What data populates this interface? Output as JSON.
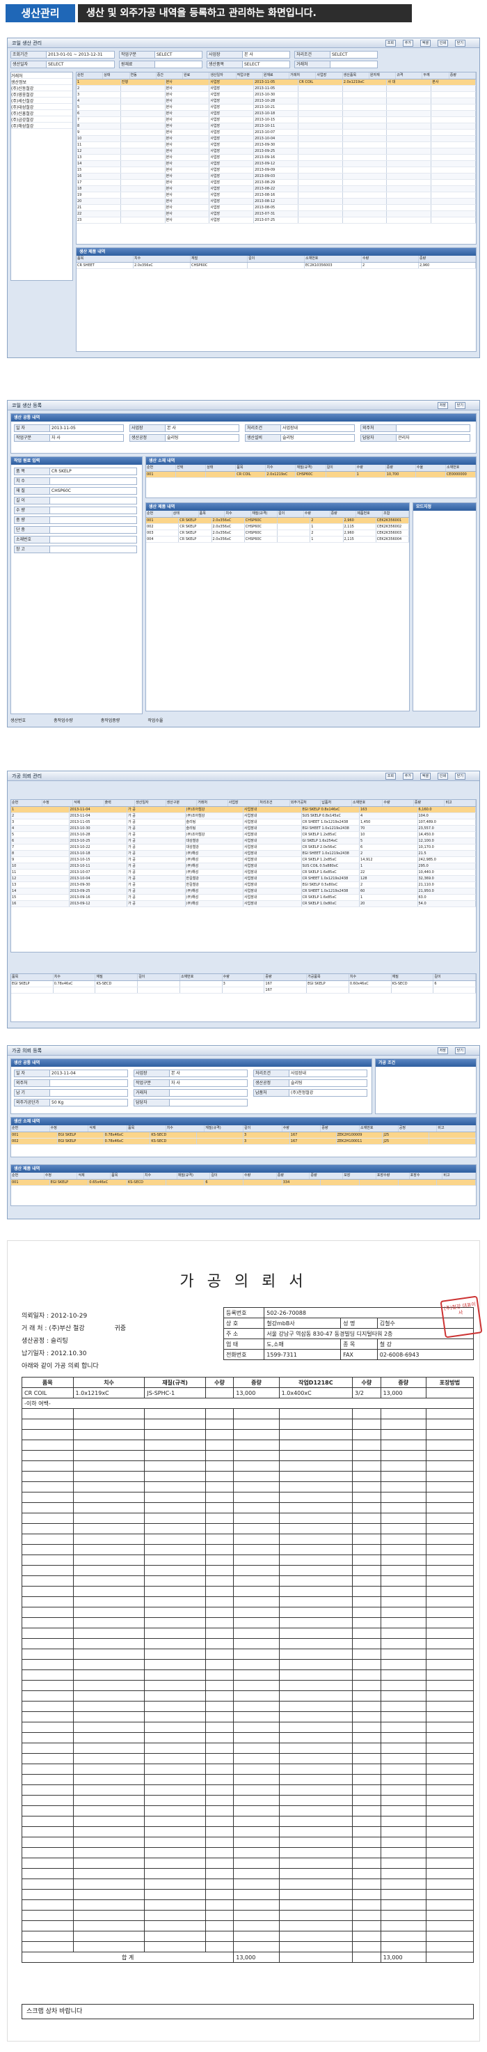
{
  "header": {
    "label": "생산관리",
    "desc": "생산 및 외주가공 내역을 등록하고 관리하는 화면입니다."
  },
  "s1": {
    "title": "코일 생산 관리",
    "buttons": [
      "조회",
      "추가",
      "엑셀",
      "인쇄",
      "닫기"
    ],
    "filters": [
      {
        "l": "조회기간",
        "v": "2013-01-01 ~ 2013-12-31"
      },
      {
        "l": "작업구분",
        "v": "SELECT"
      },
      {
        "l": "사업장",
        "v": "본 사"
      },
      {
        "l": "처리조건",
        "v": "SELECT"
      },
      {
        "l": "생산일자",
        "v": "SELECT"
      },
      {
        "l": "원재료",
        "v": ""
      },
      {
        "l": "생산품목",
        "v": "SELECT"
      },
      {
        "l": "거래처",
        "v": ""
      }
    ],
    "side": [
      "거래처",
      "생산정보",
      "(주)신동철강",
      "(주)영웅철강",
      "(주)세신철강",
      "(주)대성철강",
      "(주)신흥철강",
      "(주)금강철강",
      "(주)해성철강"
    ],
    "cols": [
      "순번",
      "상태",
      "연동",
      "중간",
      "완료",
      "생산일자",
      "작업구분",
      "원재료",
      "거래처",
      "사업장",
      "생산품목",
      "원자재",
      "규격",
      "두께",
      "중량"
    ],
    "rows": [
      [
        "1",
        "진행",
        "본사",
        "사업장",
        "2013-11-05",
        "CR COIL",
        "2.0x1219xC",
        "사 대",
        "본사"
      ],
      [
        "2",
        "",
        "본사",
        "사업장",
        "2013-11-05",
        "",
        "",
        "",
        ""
      ],
      [
        "3",
        "",
        "본사",
        "사업장",
        "2013-10-30",
        "",
        "",
        "",
        ""
      ],
      [
        "4",
        "",
        "본사",
        "사업장",
        "2013-10-28",
        "",
        "",
        "",
        ""
      ],
      [
        "5",
        "",
        "본사",
        "사업장",
        "2013-10-21",
        "",
        "",
        "",
        ""
      ],
      [
        "6",
        "",
        "본사",
        "사업장",
        "2013-10-18",
        "",
        "",
        "",
        ""
      ],
      [
        "7",
        "",
        "본사",
        "사업장",
        "2013-10-15",
        "",
        "",
        "",
        ""
      ],
      [
        "8",
        "",
        "본사",
        "사업장",
        "2013-10-11",
        "",
        "",
        "",
        ""
      ],
      [
        "9",
        "",
        "본사",
        "사업장",
        "2013-10-07",
        "",
        "",
        "",
        ""
      ],
      [
        "10",
        "",
        "본사",
        "사업장",
        "2013-10-04",
        "",
        "",
        "",
        ""
      ],
      [
        "11",
        "",
        "본사",
        "사업장",
        "2013-09-30",
        "",
        "",
        "",
        ""
      ],
      [
        "12",
        "",
        "본사",
        "사업장",
        "2013-09-25",
        "",
        "",
        "",
        ""
      ],
      [
        "13",
        "",
        "본사",
        "사업장",
        "2013-09-16",
        "",
        "",
        "",
        ""
      ],
      [
        "14",
        "",
        "본사",
        "사업장",
        "2013-09-12",
        "",
        "",
        "",
        ""
      ],
      [
        "15",
        "",
        "본사",
        "사업장",
        "2013-09-09",
        "",
        "",
        "",
        ""
      ],
      [
        "16",
        "",
        "본사",
        "사업장",
        "2013-09-03",
        "",
        "",
        "",
        ""
      ],
      [
        "17",
        "",
        "본사",
        "사업장",
        "2013-08-29",
        "",
        "",
        "",
        ""
      ],
      [
        "18",
        "",
        "본사",
        "사업장",
        "2013-08-22",
        "",
        "",
        "",
        ""
      ],
      [
        "19",
        "",
        "본사",
        "사업장",
        "2013-08-16",
        "",
        "",
        "",
        ""
      ],
      [
        "20",
        "",
        "본사",
        "사업장",
        "2013-08-12",
        "",
        "",
        "",
        ""
      ],
      [
        "21",
        "",
        "본사",
        "사업장",
        "2013-08-05",
        "",
        "",
        "",
        ""
      ],
      [
        "22",
        "",
        "본사",
        "사업장",
        "2013-07-31",
        "",
        "",
        "",
        ""
      ],
      [
        "23",
        "",
        "본사",
        "사업장",
        "2013-07-25",
        "",
        "",
        "",
        ""
      ]
    ],
    "detail_title": "생산 제품 내역",
    "dcols": [
      "품목",
      "치수",
      "재질",
      "길이",
      "소재번호",
      "수량",
      "중량"
    ],
    "drow": [
      "CR SHEET",
      "2.0x356xC",
      "CHSP60C",
      "",
      "EC2K10356003",
      "2",
      "2,960"
    ]
  },
  "s2": {
    "title": "코일 생산 등록",
    "buttons": [
      "저장",
      "닫기"
    ],
    "top_title": "생산 공통 내역",
    "fields": [
      {
        "l": "일 자",
        "v": "2013-11-05"
      },
      {
        "l": "사업장",
        "v": "본 사"
      },
      {
        "l": "처리조건",
        "v": "사업장내"
      },
      {
        "l": "외주처",
        "v": ""
      },
      {
        "l": "작업구분",
        "v": "자 사"
      },
      {
        "l": "생산공정",
        "v": "슬리팅"
      },
      {
        "l": "생산설비",
        "v": "슬리팅"
      },
      {
        "l": "담당자",
        "v": "관리자"
      }
    ],
    "mat_title": "작업 원료 입력",
    "mat_fields": [
      {
        "l": "품 목",
        "v": "CR SKELP"
      },
      {
        "l": "치 수",
        "v": ""
      },
      {
        "l": "재 질",
        "v": "CHSP60C"
      },
      {
        "l": "길 이",
        "v": ""
      },
      {
        "l": "수 량",
        "v": ""
      },
      {
        "l": "중 량",
        "v": ""
      },
      {
        "l": "단 중",
        "v": ""
      },
      {
        "l": "소재번호",
        "v": ""
      },
      {
        "l": "창 고",
        "v": ""
      }
    ],
    "src_title": "생산 소재 내역",
    "src_cols": [
      "순번",
      "선택",
      "상태",
      "품목",
      "치수",
      "재질(규격)",
      "길이",
      "수량",
      "중량",
      "수율",
      "소재번호"
    ],
    "src_row": [
      "001",
      "",
      "",
      "CR COIL",
      "2.0x1219xC",
      "CHSP60C",
      "",
      "1",
      "10,700",
      "",
      "CE0000000"
    ],
    "prod_title": "생산 제품 내역",
    "prod_cols": [
      "순번",
      "상태",
      "품목",
      "치수",
      "재질(규격)",
      "길이",
      "수량",
      "중량",
      "제품번호",
      "조합"
    ],
    "prod_rows": [
      [
        "001",
        "CR SKELP",
        "2.0x356xC",
        "CHSP60C",
        "",
        "2",
        "2,960",
        "CEK2K356001"
      ],
      [
        "002",
        "CR SKELP",
        "2.0x356xC",
        "CHSP60C",
        "",
        "1",
        "2,115",
        "CEK2K356002"
      ],
      [
        "003",
        "CR SKELP",
        "2.0x356xC",
        "CHSP60C",
        "",
        "2",
        "2,960",
        "CEK2K356003"
      ],
      [
        "004",
        "CR SKELP",
        "2.0x356xC",
        "CHSP60C",
        "",
        "1",
        "2,115",
        "CEK2K356004"
      ]
    ],
    "side_title": "모드지정",
    "footer": [
      "생산번호",
      "총작업수량",
      "총작업중량",
      "작업수율"
    ]
  },
  "s3": {
    "title": "가공 의뢰 관리",
    "buttons": [
      "조회",
      "추가",
      "엑셀",
      "인쇄",
      "닫기"
    ],
    "cols": [
      "순번",
      "수정",
      "삭제",
      "출력",
      "생산일자",
      "생산구분",
      "거래처",
      "사업장",
      "처리조건",
      "외주가공처",
      "납품처",
      "소재번호",
      "수량",
      "중량",
      "비고"
    ],
    "rows": [
      [
        "1",
        "2013-11-04",
        "가 공",
        "(주)조아철강",
        "사업장내",
        "EGI SKELP 0.8x146xC",
        "163",
        "6,160.0"
      ],
      [
        "2",
        "2013-11-04",
        "가 공",
        "(주)조아철강",
        "사업장내",
        "SUS SKELP 0.8x145xC",
        "4",
        "104.0"
      ],
      [
        "3",
        "2013-11-05",
        "가 공",
        "슬리팅",
        "사업장내",
        "CR SHEET 1.0x1219x2438",
        "1,450",
        "107,489.0"
      ],
      [
        "4",
        "2013-10-30",
        "가 공",
        "슬리팅",
        "사업장내",
        "EGI SHEET 1.0x1219x2438",
        "70",
        "23,557.0"
      ],
      [
        "5",
        "2013-10-28",
        "가 공",
        "(주)조아철강",
        "사업장내",
        "CR SKELP 1.2x85xC",
        "10",
        "14,450.0"
      ],
      [
        "6",
        "2013-10-25",
        "가 공",
        "대성철강",
        "사업장내",
        "GI SKELP 1.6x254xC",
        "5",
        "12,100.0"
      ],
      [
        "7",
        "2013-10-22",
        "가 공",
        "대성철강",
        "사업장내",
        "CR SKELP 2.0x56xC",
        "6",
        "10,170.0"
      ],
      [
        "8",
        "2013-10-18",
        "가 공",
        "(주)해성",
        "사업장내",
        "EGI SHEET 1.0x1219x2438",
        "2",
        "21.5"
      ],
      [
        "9",
        "2013-10-15",
        "가 공",
        "(주)해성",
        "사업장내",
        "CR SKELP 1.2x85xC",
        "14,912",
        "242,985.0"
      ],
      [
        "10",
        "2013-10-11",
        "가 공",
        "(주)해성",
        "사업장내",
        "SUS COIL 0.5x880xC",
        "1",
        "295.0"
      ],
      [
        "11",
        "2013-10-07",
        "가 공",
        "(주)해성",
        "사업장내",
        "CR SKELP 1.6x85xC",
        "22",
        "10,440.0"
      ],
      [
        "12",
        "2013-10-04",
        "가 공",
        "한길철강",
        "사업장내",
        "CR SHEET 1.0x1219x2438",
        "128",
        "32,369.0"
      ],
      [
        "13",
        "2013-09-30",
        "가 공",
        "한길철강",
        "사업장내",
        "EGI SKELP 0.5x80xC",
        "2",
        "21,110.0"
      ],
      [
        "14",
        "2013-09-25",
        "가 공",
        "(주)해성",
        "사업장내",
        "CR SHEET 1.0x1219x2438",
        "60",
        "21,950.0"
      ],
      [
        "15",
        "2013-09-16",
        "가 공",
        "(주)해성",
        "사업장내",
        "CR SKELP 1.6x85xC",
        "1",
        "63.0"
      ],
      [
        "16",
        "2013-09-12",
        "가 공",
        "(주)해성",
        "사업장내",
        "CR SKELP 1.0x80xC",
        "20",
        "54.0"
      ]
    ],
    "dcols": [
      "품목",
      "치수",
      "재질",
      "길이",
      "소재번호",
      "수량",
      "중량",
      "가공품목",
      "치수",
      "재질",
      "길이"
    ],
    "drows": [
      [
        "EGI SKELP",
        "0.78x46xC",
        "KS-SECD",
        "",
        "",
        "3",
        "167",
        "EGI SKELP",
        "0.60x46xC",
        "KS-SECD",
        "6"
      ],
      [
        "",
        "",
        "",
        "",
        "",
        "",
        "167",
        "",
        "",
        "",
        ""
      ]
    ]
  },
  "s4": {
    "title": "가공 의뢰 등록",
    "buttons": [
      "저장",
      "닫기"
    ],
    "top_title": "생산 공통 내역",
    "right_title": "가공 조건",
    "fields": [
      {
        "l": "일 자",
        "v": "2013-11-04"
      },
      {
        "l": "사업장",
        "v": "본 사"
      },
      {
        "l": "처리조건",
        "v": "사업장내"
      },
      {
        "l": "외주처",
        "v": ""
      },
      {
        "l": "작업구분",
        "v": "자 사"
      },
      {
        "l": "생산공정",
        "v": "슬리팅"
      },
      {
        "l": "납 기",
        "v": ""
      },
      {
        "l": "거래처",
        "v": ""
      },
      {
        "l": "납품처",
        "v": "(주)천정철강"
      },
      {
        "l": "외주가공단가",
        "v": "50 Kg"
      },
      {
        "l": "담당자",
        "v": ""
      }
    ],
    "src_title": "생산 소재 내역",
    "src_btns": [
      "소재선택",
      "소재제외"
    ],
    "src_cols": [
      "순번",
      "수정",
      "삭제",
      "품목",
      "치수",
      "재질(규격)",
      "길이",
      "수량",
      "중량",
      "소재번호",
      "공정",
      "비고"
    ],
    "src_rows": [
      [
        "001",
        "EGI SKELP",
        "0.78x46xC",
        "KS-SECD",
        "",
        "3",
        "167",
        "ZEK2H100009",
        "J25",
        ""
      ],
      [
        "002",
        "EGI SKELP",
        "0.78x46xC",
        "KS-SECD",
        "",
        "3",
        "167",
        "ZEK2H100011",
        "J25",
        ""
      ]
    ],
    "prod_title": "생산 제품 내역",
    "prod_btns": [
      "제품등록"
    ],
    "prod_cols": [
      "순번",
      "수정",
      "삭제",
      "품목",
      "치수",
      "재질(규격)",
      "길이",
      "수량",
      "중량",
      "중량",
      "포장",
      "포장수량",
      "포장수",
      "비고"
    ],
    "prod_row": [
      "001",
      "EGI SKELP",
      "0.65x46xC",
      "KS-SECD",
      "",
      "6",
      "",
      "334",
      "",
      "",
      "",
      ""
    ],
    "bottom_btns": [
      "추가",
      "삭제"
    ]
  },
  "doc": {
    "title": "가 공 의 뢰 서",
    "date_l": "의뢰일자",
    "date": "2012-10-29",
    "to_l": "거 래 처",
    "to": "(주)부산 철강",
    "to_s": "귀중",
    "proc_l": "생산공정",
    "proc": "슬리팅",
    "due_l": "납기일자",
    "due": "2012.10.30",
    "req": "아래와 같이 가공 의뢰 합니다",
    "reg_l": "등록번호",
    "reg": "502-26-70088",
    "co_l": "상 호",
    "co": "철강mbB사",
    "ceo_l": "성 명",
    "ceo": "김철수",
    "addr_l": "주 소",
    "addr": "서울 강남구 역삼동 830-47 동경빌딩 디지털타워 2층",
    "type_l": "업 태",
    "type": "도,소매",
    "item_l": "종 목",
    "item": "철 강",
    "tel_l": "전화번호",
    "tel": "1599-7311",
    "fax_l": "FAX",
    "fax": "02-6008-6943",
    "cols": [
      "품목",
      "치수",
      "재질(규격)",
      "수량",
      "중량",
      "작업D1218C",
      "수량",
      "중량",
      "포장방법"
    ],
    "row": [
      "CR COIL",
      "1.0x1219xC",
      "JS-SPHC-1",
      "",
      "13,000",
      "1.0x400xC",
      "3/2",
      "13,000",
      ""
    ],
    "end": "-이하 여백-",
    "total_l": "합 계",
    "total1": "13,000",
    "total2": "13,000",
    "note": "스크랩 상차 바랍니다",
    "stamp": "(주)철강 대표이사"
  }
}
